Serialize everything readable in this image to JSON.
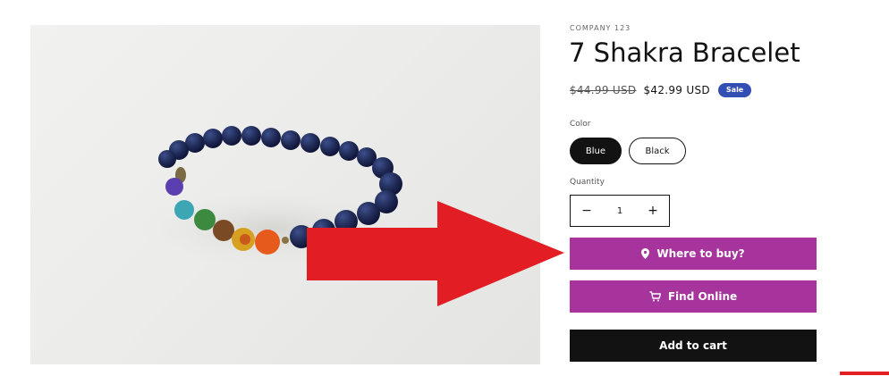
{
  "product": {
    "vendor": "COMPANY 123",
    "title": "7 Shakra Bracelet",
    "price_compare": "$44.99 USD",
    "price_sale": "$42.99 USD",
    "badge": "Sale"
  },
  "options": {
    "color_label": "Color",
    "colors": [
      "Blue",
      "Black"
    ],
    "selected_color": "Blue"
  },
  "quantity": {
    "label": "Quantity",
    "value": "1",
    "minus": "−",
    "plus": "+"
  },
  "actions": {
    "where_to_buy": "Where to buy?",
    "find_online": "Find Online",
    "add_to_cart": "Add to cart"
  },
  "colors": {
    "accent_purple": "#a7349c",
    "badge_blue": "#334fb4",
    "arrow_red": "#e21d24",
    "dark": "#121212"
  },
  "icons": {
    "where_to_buy": "map-pin-icon",
    "find_online": "cart-icon"
  }
}
